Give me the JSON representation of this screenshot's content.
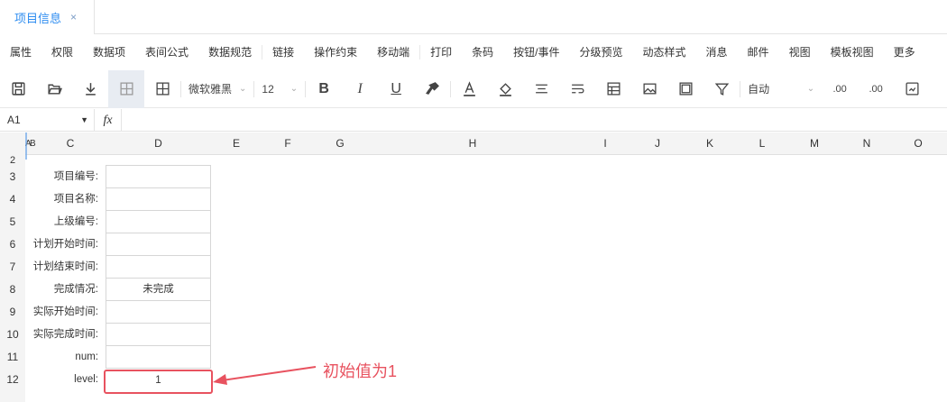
{
  "tabs": [
    {
      "label": "项目信息",
      "close": "×"
    }
  ],
  "menu": [
    "属性",
    "权限",
    "数据项",
    "表间公式",
    "数据规范",
    "链接",
    "操作约束",
    "移动端",
    "打印",
    "条码",
    "按钮/事件",
    "分级预览",
    "动态样式",
    "消息",
    "邮件",
    "视图",
    "模板视图",
    "更多"
  ],
  "toolbar": {
    "font_name": "微软雅黑",
    "font_size": "12",
    "bold": "B",
    "italic": "I",
    "underline": "U",
    "number_format": "自动",
    "dec_inc": ".00",
    "dec_dec": ".00",
    "icons": [
      "save-icon",
      "open-icon",
      "download-icon",
      "freeze-icon",
      "border-icon",
      "format-painter-icon",
      "font-color-icon",
      "fill-color-icon",
      "align-icon",
      "wrap-icon",
      "table-icon",
      "image-icon",
      "frame-icon",
      "filter-icon",
      "more-icon"
    ]
  },
  "formula_bar": {
    "cell_ref": "A1",
    "fx": "fx",
    "formula": ""
  },
  "columns": [
    "A",
    "B",
    "C",
    "D",
    "E",
    "F",
    "G",
    "H",
    "I",
    "J",
    "K",
    "L",
    "M",
    "N",
    "O"
  ],
  "rows": [
    "2",
    "3",
    "4",
    "5",
    "6",
    "7",
    "8",
    "9",
    "10",
    "11",
    "12"
  ],
  "form_fields": [
    {
      "label": "项目编号:",
      "value": ""
    },
    {
      "label": "项目名称:",
      "value": ""
    },
    {
      "label": "上级编号:",
      "value": ""
    },
    {
      "label": "计划开始时间:",
      "value": ""
    },
    {
      "label": "计划结束时间:",
      "value": ""
    },
    {
      "label": "完成情况:",
      "value": "未完成"
    },
    {
      "label": "实际开始时间:",
      "value": ""
    },
    {
      "label": "实际完成时间:",
      "value": ""
    },
    {
      "label": "num:",
      "value": ""
    },
    {
      "label": "level:",
      "value": "1"
    }
  ],
  "annotation": {
    "text": "初始值为1",
    "color": "#e8525f"
  },
  "colors": {
    "accent": "#2d8cf0",
    "annotation": "#e8525f"
  }
}
